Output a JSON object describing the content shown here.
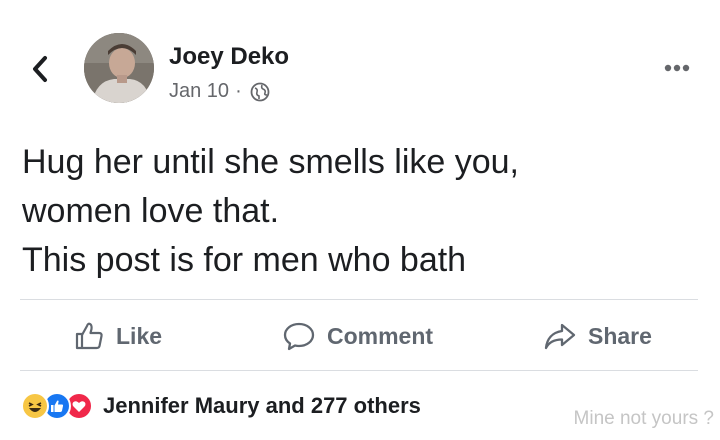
{
  "post": {
    "author": "Joey Deko",
    "date": "Jan 10",
    "separator": "·",
    "privacy_icon": "globe-icon",
    "lines": [
      "Hug her until she smells like you,",
      "women love that.",
      "This post is for men who bath"
    ]
  },
  "actions": {
    "like": "Like",
    "comment": "Comment",
    "share": "Share"
  },
  "reactions": {
    "icons": [
      "haha-reaction-icon",
      "like-reaction-icon",
      "love-reaction-icon"
    ],
    "summary": "Jennifer Maury and 277 others"
  },
  "watermark": "Mine not yours ?",
  "colors": {
    "text": "#1c1e21",
    "secondary": "#65676b",
    "action": "#606770",
    "like_blue": "#1877f2",
    "love_red": "#f0284a",
    "haha_yellow": "#f7c644"
  }
}
